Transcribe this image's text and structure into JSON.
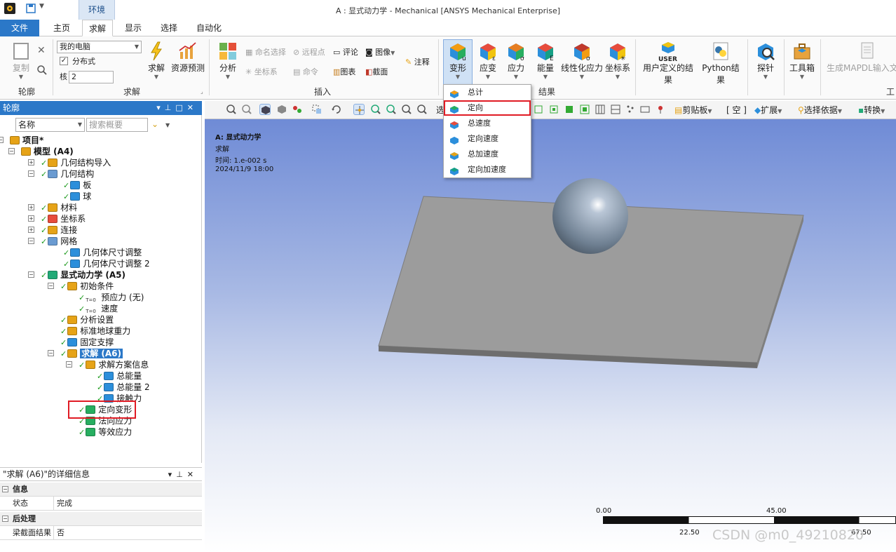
{
  "window": {
    "title": "A : 显式动力学 - Mechanical [ANSYS Mechanical Enterprise]",
    "context_tab": "环境"
  },
  "ribbon_tabs": [
    "文件",
    "主页",
    "求解",
    "显示",
    "选择",
    "自动化"
  ],
  "ribbon": {
    "outline_group": {
      "label": "轮廓",
      "copy": "复制"
    },
    "solve_group": {
      "label": "求解",
      "computer_select": "我的电脑",
      "distributed": "分布式",
      "cores_label": "核",
      "cores_value": "2",
      "solve": "求解",
      "resource_predict": "资源预测"
    },
    "insert_group": {
      "label": "插入",
      "analysis": "分析",
      "named_selection": "命名选择",
      "remote_point": "远程点",
      "comment": "评论",
      "image": "图像",
      "coordinate": "坐标系",
      "command": "命令",
      "chart": "图表",
      "section": "截面",
      "annotation": "注释"
    },
    "results_group": {
      "label": "结果",
      "deformation": "变形",
      "strain": "应变",
      "stress": "应力",
      "energy": "能量",
      "linearized_stress": "线性化应力",
      "coordinate_system": "坐标系",
      "user_defined": "用户定义的结果",
      "user_badge": "USER",
      "python": "Python结果",
      "probe": "探针",
      "toolbox": "工具箱",
      "generate_mapdl": "生成MAPDL输入文件",
      "tools_label": "工"
    }
  },
  "deformation_menu": {
    "items": [
      "总计",
      "定向",
      "总速度",
      "定向速度",
      "总加速度",
      "定向加速度"
    ],
    "highlighted": "定向"
  },
  "outline": {
    "header": "轮廓",
    "filter_name": "名称",
    "search_placeholder": "搜索概要",
    "tree": [
      {
        "text": "项目*",
        "bold": true
      },
      {
        "text": "模型 (A4)",
        "bold": true
      },
      {
        "text": "几何结构导入"
      },
      {
        "text": "几何结构"
      },
      {
        "text": "板"
      },
      {
        "text": "球"
      },
      {
        "text": "材料"
      },
      {
        "text": "坐标系"
      },
      {
        "text": "连接"
      },
      {
        "text": "网格"
      },
      {
        "text": "几何体尺寸调整"
      },
      {
        "text": "几何体尺寸调整 2"
      },
      {
        "text": "显式动力学 (A5)",
        "bold": true
      },
      {
        "text": "初始条件"
      },
      {
        "text": "预应力 (无)"
      },
      {
        "text": "速度"
      },
      {
        "text": "分析设置"
      },
      {
        "text": "标准地球重力"
      },
      {
        "text": "固定支撑"
      },
      {
        "text": "求解 (A6)",
        "bold": true,
        "selected": true
      },
      {
        "text": "求解方案信息"
      },
      {
        "text": "总能量"
      },
      {
        "text": "总能量 2"
      },
      {
        "text": "接触力"
      },
      {
        "text": "定向变形"
      },
      {
        "text": "法向应力"
      },
      {
        "text": "等效应力"
      }
    ],
    "icon_text_t0": "T=0"
  },
  "details": {
    "header": "\"求解 (A6)\"的详细信息",
    "sections": [
      {
        "title": "信息",
        "rows": [
          {
            "key": "状态",
            "value": "完成"
          }
        ]
      },
      {
        "title": "后处理",
        "rows": [
          {
            "key": "梁截面结果",
            "value": "否"
          }
        ]
      }
    ]
  },
  "view_toolbar": {
    "select_prefix": "选",
    "clipboard": "剪贴板",
    "empty": "[ 空 ]",
    "expand": "扩展",
    "select_by": "选择依据",
    "convert": "转换"
  },
  "viewport": {
    "analysis_title": "A: 显式动力学",
    "item": "求解",
    "time": "时间: 1.e-002 s",
    "date": "2024/11/9 18:00"
  },
  "scale_bar": {
    "top_labels": [
      "0.00",
      "45.00"
    ],
    "bottom_labels": [
      "22.50",
      "67.50"
    ]
  },
  "watermark": "CSDN @m0_49210820",
  "colors": {
    "accent_blue": "#2b78c8",
    "highlight_red": "#e01b24",
    "check_green": "#1d9a1d"
  }
}
